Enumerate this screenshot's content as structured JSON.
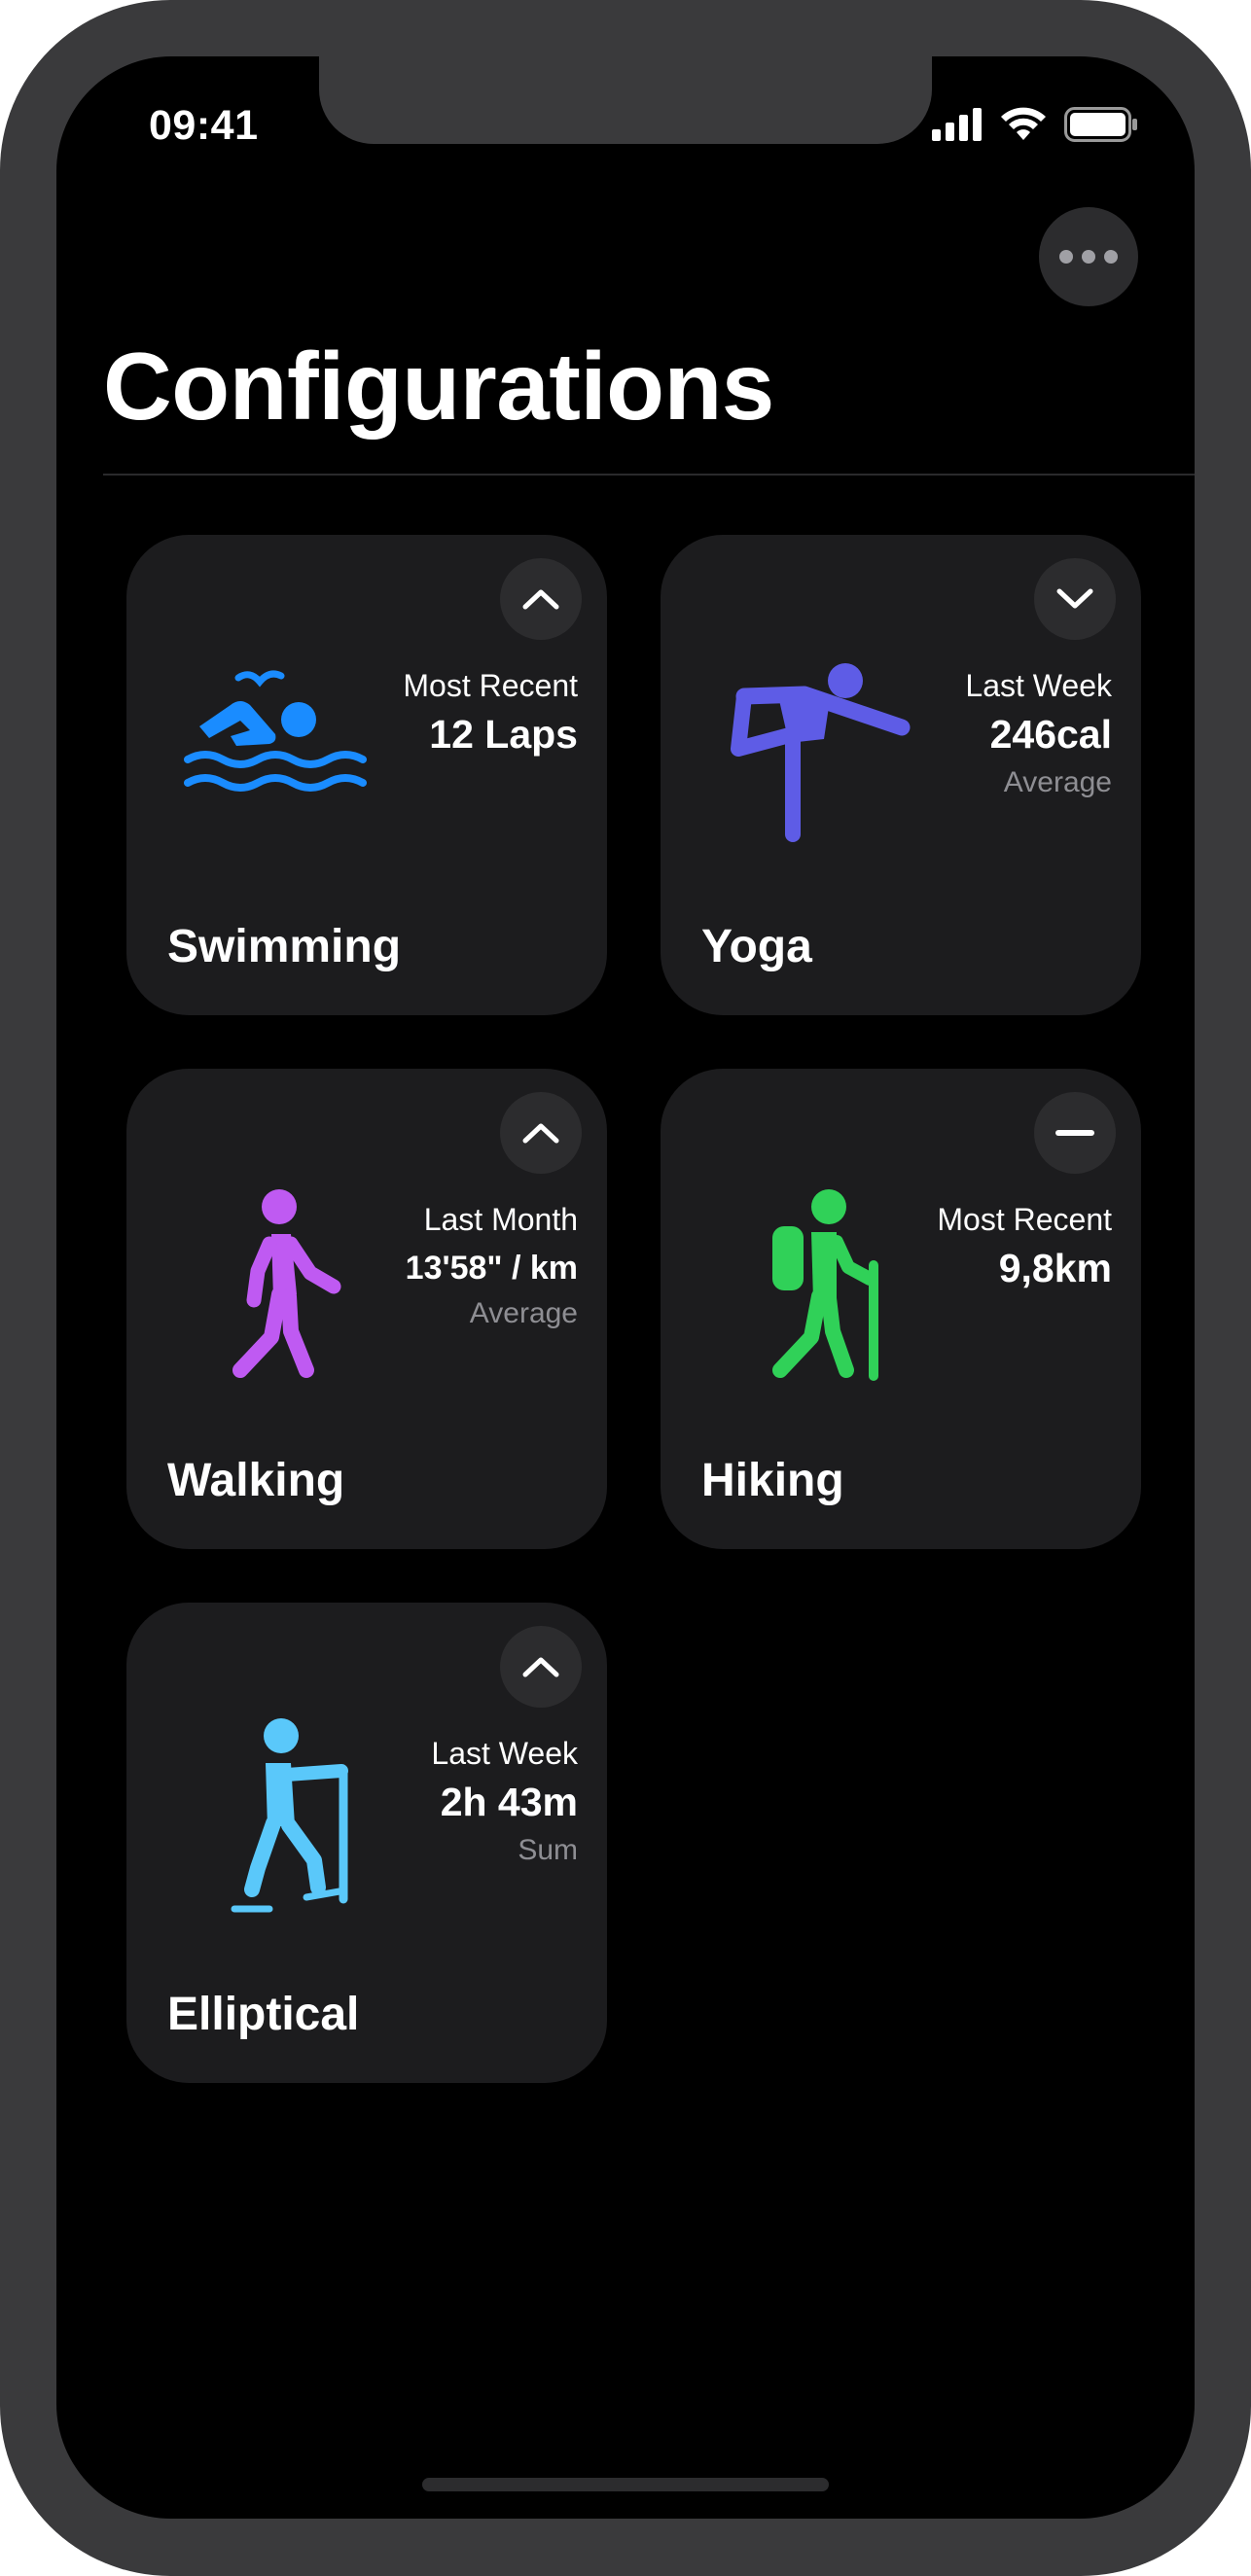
{
  "status_bar": {
    "time": "09:41"
  },
  "header": {
    "title": "Configurations",
    "more_icon": "ellipsis-icon"
  },
  "colors": {
    "swimming": "#1a8cff",
    "yoga": "#5e5ce6",
    "walking": "#bf5af2",
    "hiking": "#30d158",
    "elliptical": "#5ac8fa",
    "card_bg": "#1c1c1e"
  },
  "cards": [
    {
      "name": "Swimming",
      "period": "Most Recent",
      "value": "12 Laps",
      "aggregation": "",
      "toggle_icon": "chevron-up-icon",
      "activity_icon": "swimming-icon"
    },
    {
      "name": "Yoga",
      "period": "Last Week",
      "value": "246cal",
      "aggregation": "Average",
      "toggle_icon": "chevron-down-icon",
      "activity_icon": "yoga-icon"
    },
    {
      "name": "Walking",
      "period": "Last Month",
      "value": "13'58\" / km",
      "aggregation": "Average",
      "toggle_icon": "chevron-up-icon",
      "activity_icon": "walking-icon"
    },
    {
      "name": "Hiking",
      "period": "Most Recent",
      "value": "9,8km",
      "aggregation": "",
      "toggle_icon": "minus-icon",
      "activity_icon": "hiking-icon"
    },
    {
      "name": "Elliptical",
      "period": "Last Week",
      "value": "2h 43m",
      "aggregation": "Sum",
      "toggle_icon": "chevron-up-icon",
      "activity_icon": "elliptical-icon"
    }
  ]
}
